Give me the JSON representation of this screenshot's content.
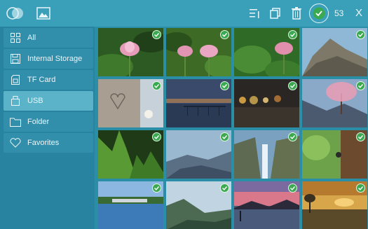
{
  "toolbar": {
    "logo_icon": "app-logo-icon",
    "gallery_icon": "image-gallery-icon",
    "list_icon": "list-sort-icon",
    "copy_icon": "copy-icon",
    "trash_icon": "trash-icon",
    "select_all_icon": "check-circle-icon",
    "selected_count": "53",
    "close_label": "X"
  },
  "sidebar": {
    "items": [
      {
        "label": "All",
        "icon": "grid-icon"
      },
      {
        "label": "Internal Storage",
        "icon": "floppy-icon"
      },
      {
        "label": "TF Card",
        "icon": "sd-card-icon"
      },
      {
        "label": "USB",
        "icon": "usb-icon"
      },
      {
        "label": "Folder",
        "icon": "folder-icon"
      },
      {
        "label": "Favorites",
        "icon": "heart-icon"
      }
    ],
    "active_index": 3
  },
  "photos": [
    {
      "subject": "lotus-flower",
      "selected": true
    },
    {
      "subject": "lotus-flowers",
      "selected": true
    },
    {
      "subject": "lotus-leaves",
      "selected": true
    },
    {
      "subject": "rocky-mountain",
      "selected": true
    },
    {
      "subject": "heart-in-sand",
      "selected": true
    },
    {
      "subject": "pier-at-dusk",
      "selected": true
    },
    {
      "subject": "bokeh-lights",
      "selected": true
    },
    {
      "subject": "blossom-tree",
      "selected": true
    },
    {
      "subject": "fern-plant",
      "selected": true
    },
    {
      "subject": "misty-hills",
      "selected": true
    },
    {
      "subject": "waterfall",
      "selected": true
    },
    {
      "subject": "tree-climber",
      "selected": true
    },
    {
      "subject": "lake-town",
      "selected": true
    },
    {
      "subject": "mountain-valley",
      "selected": true
    },
    {
      "subject": "sunset-lake",
      "selected": true
    },
    {
      "subject": "golden-sunset",
      "selected": true
    }
  ],
  "colors": {
    "toolbar_bg": "#3a9fb8",
    "sidebar_bg": "#2783a0",
    "active_item": "#5bb3c9",
    "check_green": "#3aa94f"
  }
}
